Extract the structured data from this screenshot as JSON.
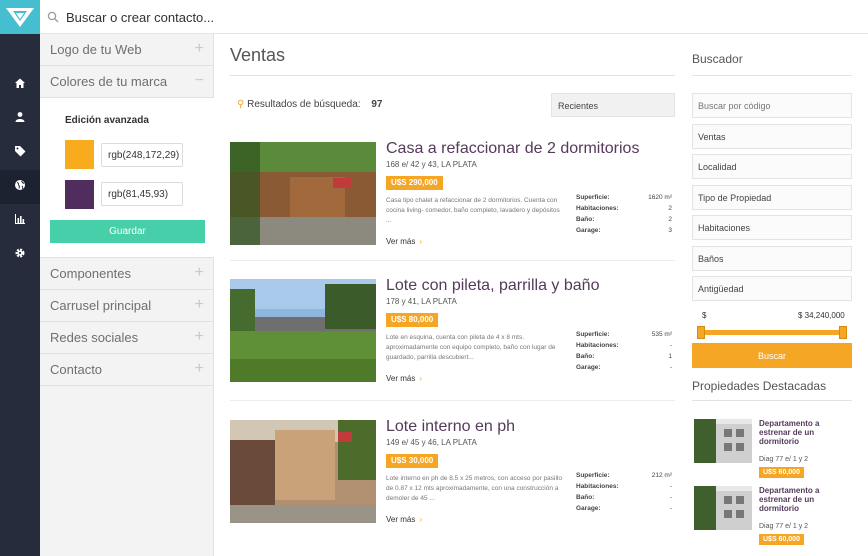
{
  "topbar": {
    "search_placeholder": "Buscar o crear contacto..."
  },
  "rail": {
    "icons": [
      "home-icon",
      "user-icon",
      "tags-icon",
      "globe-icon",
      "bar-chart-icon",
      "gear-icon"
    ],
    "active": "globe-icon"
  },
  "panel": {
    "items": [
      {
        "label": "Logo de tu Web",
        "toggle": "+"
      },
      {
        "label": "Colores de tu marca",
        "toggle": "−"
      },
      {
        "label": "Componentes",
        "toggle": "+"
      },
      {
        "label": "Carrusel principal",
        "toggle": "+"
      },
      {
        "label": "Redes sociales",
        "toggle": "+"
      },
      {
        "label": "Contacto",
        "toggle": "+"
      }
    ],
    "brand": {
      "advanced_title": "Edición avanzada",
      "color1": {
        "swatch": "#f8ac1d",
        "value": "rgb(248,172,29)"
      },
      "color2": {
        "swatch": "#512d5d",
        "value": "rgb(81,45,93)"
      },
      "save_label": "Guardar"
    }
  },
  "main": {
    "title": "Ventas",
    "results_label": "Resultados de búsqueda:",
    "results_count": "97",
    "sort_value": "Recientes",
    "listings": [
      {
        "title": "Casa a refaccionar de 2 dormitorios",
        "address": "168 e/ 42 y 43, LA PLATA",
        "price": "U$S 290,000",
        "description": "Casa tipo chalet a refaccionar de 2 dormitorios. Cuenta con cocina  living- comedor, baño completo, lavadero y depósitos ...",
        "more": "Ver más",
        "specs": [
          {
            "k": "Superficie:",
            "v": "1620 m²"
          },
          {
            "k": "Habitaciones:",
            "v": "2"
          },
          {
            "k": "Baño:",
            "v": "2"
          },
          {
            "k": "Garage:",
            "v": "3"
          }
        ]
      },
      {
        "title": "Lote con pileta, parrilla y baño",
        "address": "178 y 41, LA PLATA",
        "price": "U$S 80,000",
        "description": "Lote en esquina, cuenta con pileta de 4 x 8 mts. aproximadamente con equipo completo, baño con lugar de guardado, parrilla descubiert...",
        "more": "Ver más",
        "specs": [
          {
            "k": "Superficie:",
            "v": "535 m²"
          },
          {
            "k": "Habitaciones:",
            "v": "-"
          },
          {
            "k": "Baño:",
            "v": "1"
          },
          {
            "k": "Garage:",
            "v": "-"
          }
        ]
      },
      {
        "title": "Lote interno en ph",
        "address": "149 e/ 45 y 46, LA PLATA",
        "price": "U$S 30,000",
        "description": "Lote interno en ph de 8.5 x 25 metros, con acceso por pasillo de 0.87 x 12 mts aproximadamente, con una construcción a demoler de 45 ...",
        "more": "Ver más",
        "specs": [
          {
            "k": "Superficie:",
            "v": "212 m²"
          },
          {
            "k": "Habitaciones:",
            "v": "-"
          },
          {
            "k": "Baño:",
            "v": "-"
          },
          {
            "k": "Garage:",
            "v": "-"
          }
        ]
      }
    ]
  },
  "sidebar": {
    "title": "Buscador",
    "fields": [
      "Buscar por código",
      "Ventas",
      "Localidad",
      "Tipo de Propiedad",
      "Habitaciones",
      "Baños",
      "Antigüedad"
    ],
    "range_min": "$",
    "range_max": "$ 34,240,000",
    "search_label": "Buscar",
    "featured_title": "Propiedades Destacadas",
    "featured": [
      {
        "title": "Departamento a estrenar de un dormitorio",
        "address": "Diag 77 e/ 1 y 2",
        "price": "U$S 60,000"
      },
      {
        "title": "Departamento a estrenar de un dormitorio",
        "address": "Diag 77 e/ 1 y 2",
        "price": "U$S 60,000"
      }
    ]
  }
}
